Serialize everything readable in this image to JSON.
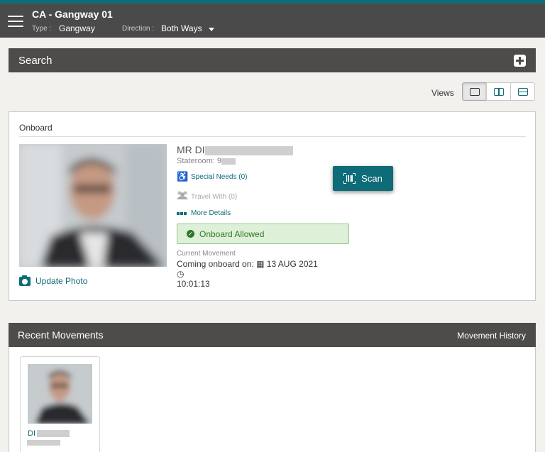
{
  "header": {
    "title": "CA - Gangway 01",
    "type_label": "Type :",
    "type_value": "Gangway",
    "direction_label": "Direction :",
    "direction_value": "Both Ways"
  },
  "search": {
    "title": "Search"
  },
  "views": {
    "label": "Views"
  },
  "onboard": {
    "title": "Onboard",
    "name": "MR DI",
    "stateroom": "Stateroom: 9",
    "special_needs": "Special Needs (0)",
    "travel_with": "Travel With (0)",
    "more_details": "More Details",
    "status": "Onboard Allowed",
    "movement_label": "Current Movement",
    "movement_prefix": "Coming onboard on:",
    "movement_date": "13 AUG 2021",
    "movement_time": "10:01:13",
    "update_photo": "Update Photo",
    "scan_label": "Scan"
  },
  "recent": {
    "title": "Recent Movements",
    "history_link": "Movement History",
    "items": [
      {
        "name": "DI"
      }
    ]
  },
  "colors": {
    "accent": "#0e6b78",
    "header": "#4a4a4a",
    "success_bg": "#dff0d8",
    "success_text": "#2b7a2b"
  }
}
